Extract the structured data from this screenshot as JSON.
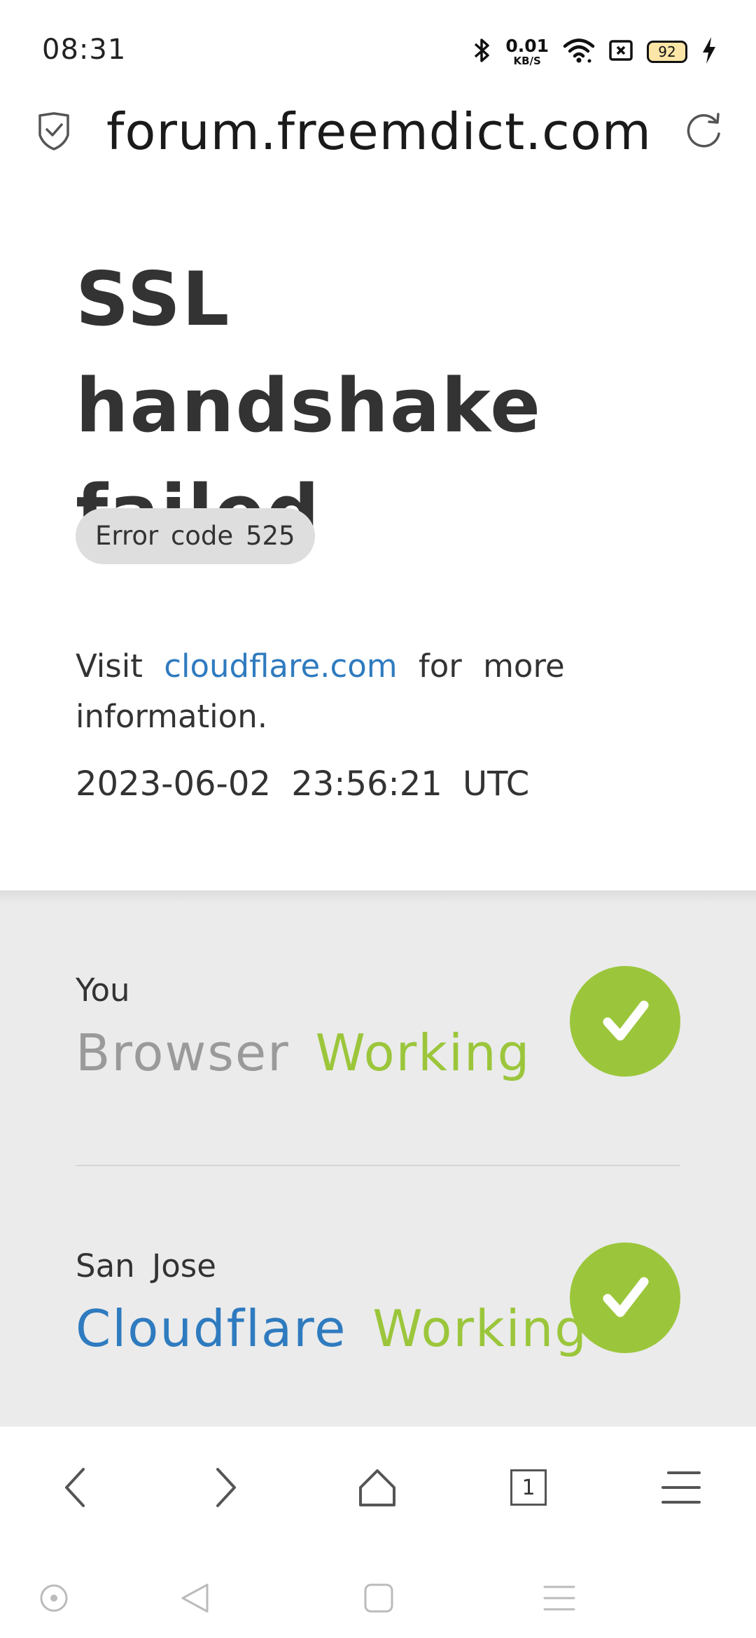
{
  "status_bar": {
    "time": "08:31",
    "net_speed_value": "0.01",
    "net_speed_unit": "KB/S",
    "battery": "92",
    "icons": [
      "bluetooth-icon",
      "wifi-icon",
      "sim-off-icon",
      "battery-icon",
      "charging-icon"
    ]
  },
  "address_bar": {
    "url": "forum.freemdict.com",
    "icons": [
      "shield-check-icon",
      "reload-icon"
    ]
  },
  "error": {
    "title": "SSL handshake failed",
    "code_label": "Error code 525",
    "info_prefix": "Visit",
    "info_link": "cloudflare.com",
    "info_suffix": "for more information.",
    "timestamp": "2023-06-02 23:56:21 UTC"
  },
  "status_panel": {
    "rows": [
      {
        "caption": "You",
        "name": "Browser",
        "status": "Working"
      },
      {
        "caption": "San Jose",
        "name": "Cloudflare",
        "status": "Working"
      }
    ],
    "colors": {
      "working": "#9bc63b",
      "link": "#2f7bbf",
      "browser": "#9a9a9a"
    }
  },
  "toolbar": {
    "tab_count": "1",
    "icons": [
      "back-icon",
      "forward-icon",
      "home-icon",
      "tabs-icon",
      "menu-icon"
    ]
  },
  "system_nav": {
    "icons": [
      "assistant-icon",
      "back-triangle-icon",
      "recents-square-icon",
      "menu-lines-icon"
    ]
  }
}
